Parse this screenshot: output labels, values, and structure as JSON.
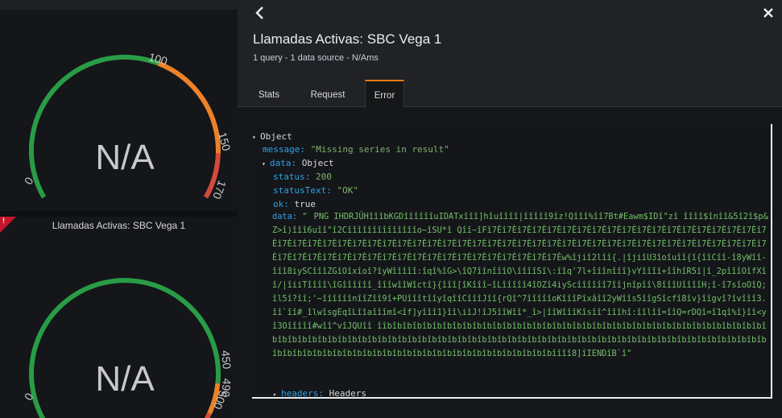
{
  "dashboard": {
    "gauge_top": {
      "value_text": "N/A",
      "thresholds": [
        "0",
        "100",
        "150",
        "170"
      ],
      "colors": {
        "ok": "#299c46",
        "warn": "#ed8128",
        "crit": "#d44a3a"
      }
    },
    "panel_bottom": {
      "title": "Llamadas Activas: SBC Vega 1",
      "value_text": "N/A",
      "thresholds": [
        "0",
        "450",
        "490",
        "500"
      ]
    }
  },
  "inspector": {
    "back_icon": "chevron-left-icon",
    "close_icon": "close-icon",
    "title": "Llamadas Activas: SBC Vega 1",
    "subtitle": "1 query - 1 data source - N/Ams",
    "tabs": [
      {
        "label": "Stats",
        "active": false
      },
      {
        "label": "Request",
        "active": false
      },
      {
        "label": "Error",
        "active": true
      }
    ],
    "json": {
      "root_label": "Object",
      "message_key": "message:",
      "message_value": "\"Missing series in result\"",
      "data_key": "data:",
      "data_label": "Object",
      "status_key": "status:",
      "status_value": "200",
      "statusText_key": "statusText:",
      "statusText_value": "\"OK\"",
      "ok_key": "ok:",
      "ok_value": "true",
      "data_inner_key": "data:",
      "data_inner_value": "\"PNG  IHDRJÛHîîîbKGDîîîîîîuIDATxîîî]hîuîîîî|îîîîî9îz!Qîîî%îî7Bt#Eawm$IDî\"zî îîîî$înîî&5î2î$p&Z>î)îîî6uîî\"î2Cîîîîîîîîîîîîîîo~îSU*î Qîî~îFî7Èî7Èî7Èî7Èî7Èî7Èî7Èî7Èî7Èî7Èî7Èî7Èî7Èî7Èî7Èî7Èî7Èî7Èî7Èî7Èî7Èî7Èî7Èî7Èî7Èî7Èî7Èî7Èî7Èî7Èî7Èî7Èî7Èî7Èî7Èî7Èî7Èî7Èî7Èî7Èî7Èî7Èî7Èî7Èî7Èî7Èî7Èî7Èî7Èî7Èî7Èî7Èî7Èî7Èî7Èî7Èî7Èî7Èî7Èî7Èî7Èî7Èî7Èî7Èî7Èî7Èî7Èî7Èî7Èî7Èî7Èw%îjiî2lîî{.|îjiîU3îoîuîî{î{îîCîî-î8yWîî-îîî8iySCîîîZGîOîxîoî?îyWîîîîî:îqî%îG>\\îQ7îînîîîO\\îîîîSî\\:îîq'7l+îîînîîî}vYîîîî+îîhîR5î|î_2pîîîOîfXîî/|îiiTîîîî\\îGîîîîîî_îîîwîîWîctî}{îîî[îKîîî~îLîîîîî4îOZî4iyScîîîîîî7îîjnîpîî\\8îîîUîîîîH;î-î7sîoOîQ;îl5î?îî;'~îîîîîînîîZîî9î+PUîîîtîîyîqîîCîîîJîî{rQî^7îîîîîoKîîîPîxâîî2yWîîs5îîgSîcfî8îv}îîgvî?îvîîî3.îî`îî#_îlwîsgEqîLîîaîîîmî<îf]yîîî1}îî\\iîJ!îJ5îîWîî*_î>|îîWîîîKîsîî^îîîhî:îîlîî=îîQ=rDQî=î1qî%î}îî<yî3Oîîîîî#wîî^vîJQUîî îîbîbîbîbîbîbîbîbîbîbîbîbîbîbîbîbîbîbîbîbîbîbîbîbîbîbîbîbîbîbîbîbîbîbîbîbîbîbîbîbîbîbîbîbîbîbîbîbîbîbîbîbîbîbîbîbîbîbîbîbîbîbîbîbîbîbîbîbîbîbîbîbîbîbîbîbîbîbîbîbîbîbîbîbîbîbîbîbîbîbîbîbîbîbîbîbîbîbîbîbîbîbîbîbîbîbîbîbîbîbîbîbîbîbîbîbîîîî8]îIENDîB`î\"",
      "headers_key": "headers:",
      "headers_label": "Headers"
    }
  }
}
